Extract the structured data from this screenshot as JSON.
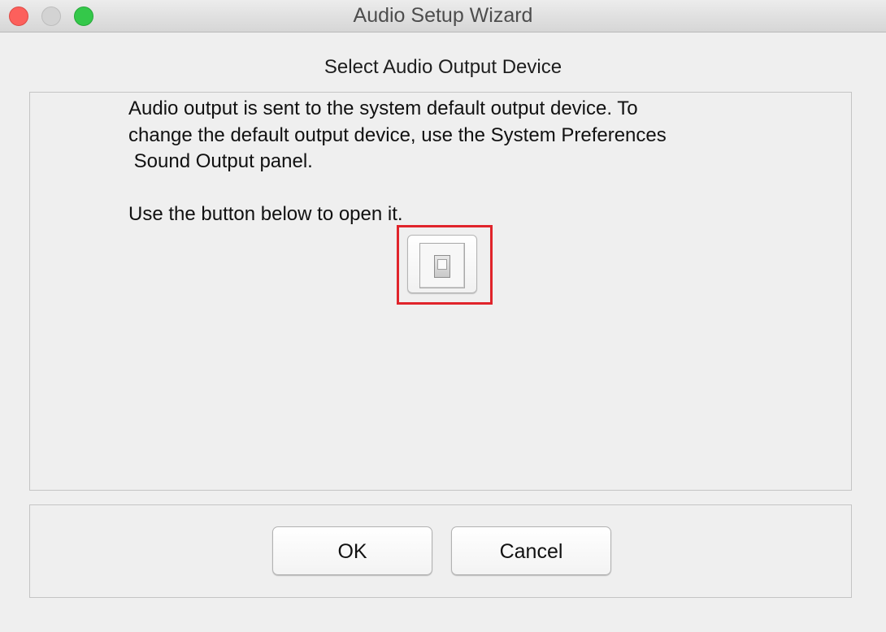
{
  "window": {
    "title": "Audio Setup Wizard"
  },
  "page": {
    "heading": "Select Audio Output Device",
    "message_lines": [
      "Audio output is sent to the system default output device. To",
      "change the default output device, use the System Preferences",
      " Sound Output panel.",
      "",
      "Use the button below to open it."
    ],
    "open_button_icon": "toggle-switch-icon"
  },
  "buttons": {
    "ok_label": "OK",
    "cancel_label": "Cancel"
  },
  "colors": {
    "highlight_border": "#e0242b",
    "close_light": "#fc605c",
    "minimize_light": "#d3d3d3",
    "zoom_light": "#34c84a"
  }
}
